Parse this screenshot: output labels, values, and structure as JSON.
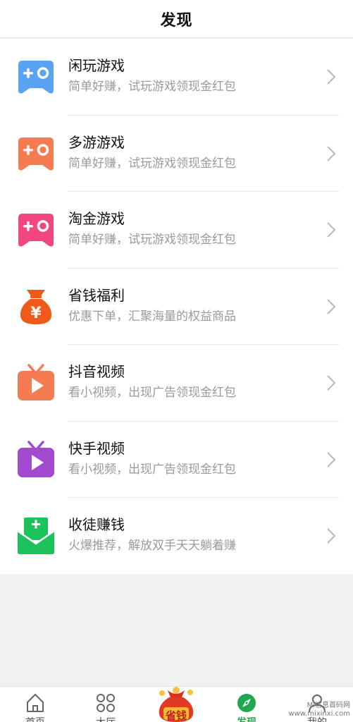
{
  "header": {
    "title": "发现"
  },
  "items": [
    {
      "name": "闲玩游戏",
      "desc": "简单好赚，试玩游戏领现金红包",
      "icon": "gamepad-icon",
      "color": "#5aa3f0"
    },
    {
      "name": "多游游戏",
      "desc": "简单好赚，试玩游戏领现金红包",
      "icon": "gamepad-icon",
      "color": "#f47c50"
    },
    {
      "name": "淘金游戏",
      "desc": "简单好赚，试玩游戏领现金红包",
      "icon": "gamepad-icon",
      "color": "#f2467e"
    },
    {
      "name": "省钱福利",
      "desc": "优惠下单，汇聚海量的权益商品",
      "icon": "money-bag-icon",
      "color": "#ef5a1a"
    },
    {
      "name": "抖音视频",
      "desc": "看小视频，出现广告领现金红包",
      "icon": "tv-play-icon",
      "color": "#f47c50"
    },
    {
      "name": "快手视频",
      "desc": "看小视频，出现广告领现金红包",
      "icon": "tv-play-icon",
      "color": "#a24bd0"
    },
    {
      "name": "收徒赚钱",
      "desc": "火爆推荐，解放双手天天躺着赚",
      "icon": "envelope-plus-icon",
      "color": "#1cc35a"
    }
  ],
  "tabbar": {
    "tabs": [
      {
        "label": "首页",
        "icon": "home-icon"
      },
      {
        "label": "大厅",
        "icon": "grid-icon"
      },
      {
        "label": "省钱",
        "icon": "money-bag-icon"
      },
      {
        "label": "发现",
        "icon": "compass-icon",
        "active": true
      },
      {
        "label": "我的",
        "icon": "user-icon"
      }
    ],
    "active_color": "#1fa84f"
  },
  "watermark": {
    "line1": "Mi信息首码网",
    "line2": "www.mixinxi.com"
  }
}
